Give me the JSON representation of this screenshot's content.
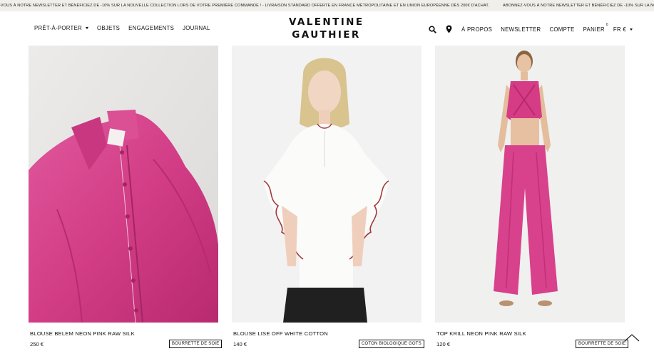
{
  "announcement": {
    "text_1": "ZY-VOUS À NOTRE NEWSLETTER ET BÉNÉFICIEZ DE -10% SUR LA NOUVELLE COLLECTION LORS DE VOTRE PREMIÈRE COMMANDE ! - LIVRAISON STANDARD OFFERTE EN FRANCE MÉTROPOLITAINE ET EN UNION EUROPÉENNE DÈS 200€ D'ACHAT.",
    "text_2": "ABONNEZ-VOUS À NOTRE NEWSLETTER ET BÉNÉFICIEZ DE -10% SUR LA NOUVELLE"
  },
  "header": {
    "logo_line1": "VALENTINE",
    "logo_line2": "GAUTHIER",
    "nav_left": [
      "PRÊT-À-PORTER",
      "OBJETS",
      "ENGAGEMENTS",
      "JOURNAL"
    ],
    "nav_right": {
      "about": "À PROPOS",
      "newsletter": "NEWSLETTER",
      "account": "COMPTE",
      "cart": "PANIER",
      "cart_count": "0",
      "locale": "FR €"
    },
    "icons": [
      "search-icon",
      "location-pin-icon",
      "chevron-down-icon"
    ]
  },
  "products": [
    {
      "name": "BLOUSE BELEM NEON PINK RAW SILK",
      "price": "250 €",
      "tag": "BOURRETTE DE SOIE"
    },
    {
      "name": "BLOUSE LISE OFF WHITE COTTON",
      "price": "140 €",
      "tag": "COTON BIOLOGIQUE GOTS"
    },
    {
      "name": "TOP KRILL NEON PINK RAW SILK",
      "price": "120 €",
      "tag": "BOURRETTE DE SOIE"
    }
  ],
  "colors": {
    "announcement_bg": "#f1efe9",
    "neon_pink": "#d83b8a",
    "text": "#111111"
  }
}
